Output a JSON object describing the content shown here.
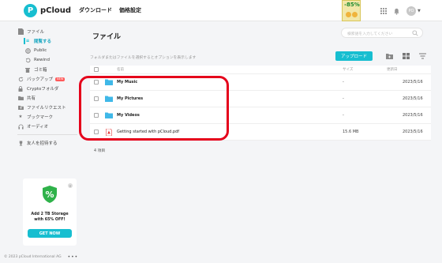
{
  "header": {
    "logo_text": "pCloud",
    "logo_mark": "P",
    "nav": [
      "ダウンロード",
      "価格設定"
    ],
    "promo_text": "-85%",
    "avatar_initials": "PO"
  },
  "sidebar": {
    "items": [
      {
        "label": "ファイル",
        "icon": "file-icon",
        "level": 0
      },
      {
        "label": "閲覧する",
        "icon": "list-icon",
        "level": 1,
        "active": true
      },
      {
        "label": "Public",
        "icon": "globe-icon",
        "level": 1
      },
      {
        "label": "Rewind",
        "icon": "rewind-icon",
        "level": 1
      },
      {
        "label": "ゴミ箱",
        "icon": "trash-icon",
        "level": 1
      },
      {
        "label": "バックアップ",
        "icon": "backup-icon",
        "level": 0,
        "badge": "NEW"
      },
      {
        "label": "Cryptoフォルダ",
        "icon": "lock-icon",
        "level": 0
      },
      {
        "label": "共有",
        "icon": "share-icon",
        "level": 0
      },
      {
        "label": "ファイルリクエスト",
        "icon": "upload-request-icon",
        "level": 0
      },
      {
        "label": "ブックマーク",
        "icon": "star-icon",
        "level": 0
      },
      {
        "label": "オーディオ",
        "icon": "headphones-icon",
        "level": 0
      },
      {
        "label": "友人を招待する",
        "icon": "trophy-icon",
        "level": 0
      }
    ]
  },
  "upsell": {
    "text": "Add 2 TB Storage with 65% OFF!",
    "button": "GET NOW"
  },
  "footer": {
    "copyright": "© 2023 pCloud International AG",
    "more": "•••"
  },
  "main": {
    "title": "ファイル",
    "search_placeholder": "検索語を入力してください",
    "hint": "フォルダまたはファイルを選択するとオプションを表示します",
    "upload_label": "アップロード",
    "columns": {
      "name": "名前",
      "size": "サイズ",
      "date": "更新日"
    },
    "rows": [
      {
        "name": "My Music",
        "type": "folder",
        "size": "-",
        "date": "2023/5/16"
      },
      {
        "name": "My Pictures",
        "type": "folder",
        "size": "-",
        "date": "2023/5/16"
      },
      {
        "name": "My Videos",
        "type": "folder",
        "size": "-",
        "date": "2023/5/16"
      },
      {
        "name": "Getting started with pCloud.pdf",
        "type": "pdf",
        "size": "15.6 MB",
        "date": "2023/5/16"
      }
    ],
    "item_count": "4 項目"
  },
  "colors": {
    "accent": "#17bed0",
    "highlight": "#e5001b",
    "folder": "#3fb8e8",
    "pdf": "#e22b2b"
  }
}
